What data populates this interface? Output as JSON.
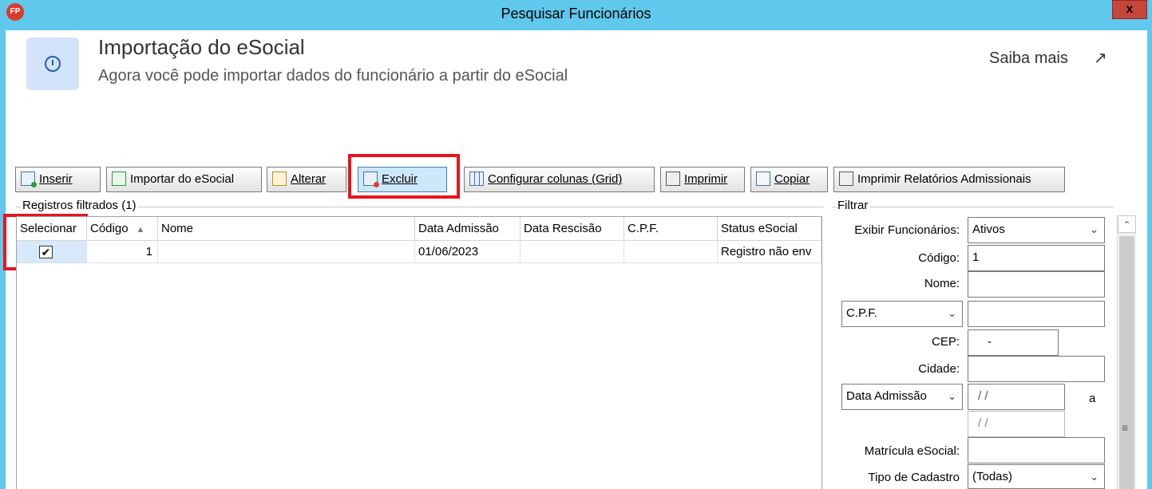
{
  "window": {
    "title": "Pesquisar Funcionários",
    "app_icon_text": "FP",
    "close_label": "x"
  },
  "banner": {
    "title": "Importação do eSocial",
    "subtitle": "Agora você pode importar dados do funcionário a partir do eSocial",
    "link": "Saiba mais",
    "link_arrow": "↗"
  },
  "toolbar": {
    "inserir": "Inserir",
    "importar": "Importar do eSocial",
    "alterar": "Alterar",
    "excluir": "Excluir",
    "configurar": "Configurar colunas (Grid)",
    "imprimir": "Imprimir",
    "copiar": "Copiar",
    "relatorios": "Imprimir Relatórios Admissionais"
  },
  "grid": {
    "group_label": "Registros filtrados (1)",
    "columns": [
      "Selecionar",
      "Código",
      "Nome",
      "Data Admissão",
      "Data Rescisão",
      "C.P.F.",
      "Status eSocial"
    ],
    "rows": [
      {
        "selected": "✔",
        "codigo": "1",
        "nome": "",
        "data_admissao": "01/06/2023",
        "data_rescisao": "",
        "cpf": "",
        "status": "Registro não env"
      }
    ]
  },
  "filter": {
    "group_label": "Filtrar",
    "exibir_label": "Exibir Funcionários:",
    "exibir_value": "Ativos",
    "codigo_label": "Código:",
    "codigo_value": "1",
    "nome_label": "Nome:",
    "nome_value": "",
    "doc_type_value": "C.P.F.",
    "doc_value": "",
    "cep_label": "CEP:",
    "cep_value": "-",
    "cidade_label": "Cidade:",
    "cidade_value": "",
    "date_type_value": "Data Admissão",
    "date_from": "/ /",
    "date_sep": "a",
    "date_to": "/ /",
    "matricula_label": "Matrícula eSocial:",
    "matricula_value": "",
    "tipo_label": "Tipo de Cadastro",
    "tipo_value": "(Todas)"
  },
  "colors": {
    "title_bar": "#5fc8ec",
    "highlight": "#e8141e",
    "banner_icon_bg": "#d3e3fa"
  }
}
